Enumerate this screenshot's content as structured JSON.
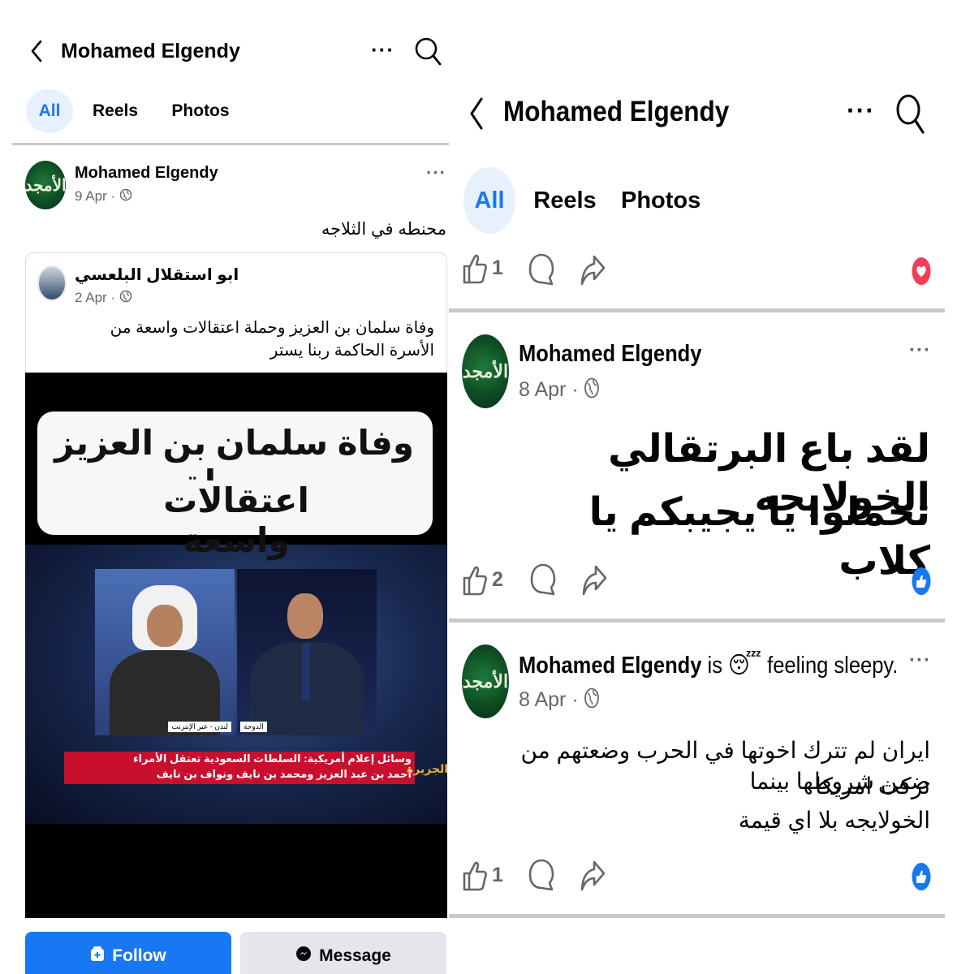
{
  "left": {
    "header": {
      "title": "Mohamed Elgendy"
    },
    "tabs": [
      {
        "label": "All"
      },
      {
        "label": "Reels"
      },
      {
        "label": "Photos"
      }
    ],
    "post": {
      "author": "Mohamed Elgendy",
      "date": "9 Apr",
      "text": "محنطه في الثلاجه",
      "shared": {
        "author": "ابو استقلال البلعسي",
        "date": "2 Apr",
        "text": "وفاة سلمان بن العزيز وحملة اعتقالات واسعة من الأسرة الحاكمة ربنا يستر",
        "video": {
          "caption_line1": "وفاة سلمان بن العزيز وحملة",
          "caption_line2": "اعتقالات واسعة",
          "label_left": "لندن - عبر الإنترنت",
          "label_right": "الدوحة",
          "ticker_line1": "وسائل إعلام أمريكية: السلطات السعودية تعتقل الأمراء",
          "ticker_line2": "أحمد بن عبد العزيز ومحمد بن نايف ونواف بن نايف",
          "channel": "الجزيرة"
        }
      }
    },
    "buttons": {
      "follow": "Follow",
      "message": "Message"
    }
  },
  "right": {
    "header": {
      "title": "Mohamed Elgendy"
    },
    "tabs": [
      {
        "label": "All"
      },
      {
        "label": "Reels"
      },
      {
        "label": "Photos"
      }
    ],
    "top_actions": {
      "like_count": "1"
    },
    "posts": [
      {
        "author": "Mohamed Elgendy",
        "date": "8 Apr",
        "text_line1": "لقد باع البرتقالي الخولايجه",
        "text_line2": "تحملوا يا يجيبكم يا كلاب",
        "like_count": "2"
      },
      {
        "author": "Mohamed Elgendy",
        "feeling_prefix": "is",
        "feeling_emoji": "😴",
        "feeling_text": "feeling sleepy.",
        "date": "8 Apr",
        "text_line1": "ايران لم تترك اخوتها في الحرب وضعتهم من ضمن شروطها بينما",
        "text_line2": "تركت امريكا",
        "text_line3": "الخولايجه بلا اي قيمة",
        "like_count": "1"
      }
    ]
  },
  "colors": {
    "brand": "#1877f2",
    "muted": "#65676b",
    "tab_active_bg": "#e7f0fd",
    "love": "#f33e58",
    "divider": "#c7c9cd"
  },
  "icons": [
    "back-icon",
    "more-icon",
    "search-icon",
    "globe-icon",
    "like-icon",
    "comment-icon",
    "share-icon",
    "love-reaction-icon",
    "like-reaction-icon",
    "follow-icon",
    "messenger-icon"
  ]
}
